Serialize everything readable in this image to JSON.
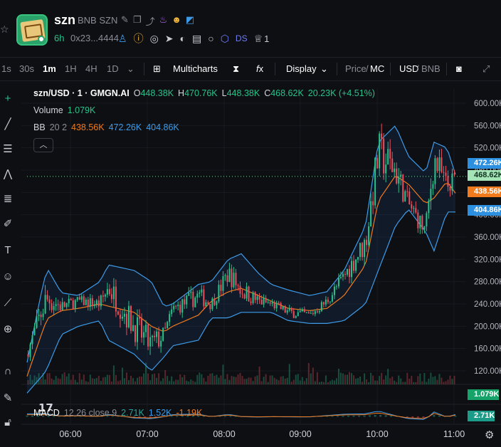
{
  "header": {
    "token_name": "szn",
    "token_subtitle": "BNB SZN",
    "age": "6h",
    "address": "0x23...4444",
    "ds_label": "DS",
    "watch_count": "1"
  },
  "toolbar": {
    "intervals": [
      "1s",
      "30s",
      "1m",
      "1H",
      "4H",
      "1D"
    ],
    "active_interval": "1m",
    "multicharts_label": "Multicharts",
    "display_label": "Display",
    "price_label": "Price",
    "mc_label": "MC",
    "usd_label": "USD",
    "bnb_label": "BNB"
  },
  "legend": {
    "symbol": "szn/USD · 1 · GMGN.AI",
    "ohlc": {
      "o_label": "O",
      "o": "448.38K",
      "h_label": "H",
      "h": "470.76K",
      "l_label": "L",
      "l": "448.38K",
      "c_label": "C",
      "c": "468.62K",
      "change": "20.23K (+4.51%)"
    },
    "volume_label": "Volume",
    "volume_value": "1.079K",
    "bb_label": "BB",
    "bb_params": "20 2",
    "bb_basis": "438.56K",
    "bb_upper": "472.26K",
    "bb_lower": "404.86K"
  },
  "macd": {
    "label": "MACD",
    "params": "12 26 close 9",
    "macd": "2.71K",
    "signal": "1.52K",
    "hist": "-1.19K"
  },
  "price_tags": {
    "upper": "472.26K",
    "last": "468.62K",
    "basis": "438.56K",
    "lower": "404.86K",
    "volume": "1.079K",
    "macd": "2.71K"
  },
  "colors": {
    "up": "#29c28a",
    "down": "#e8505b",
    "basis": "#f07a1c",
    "bands": "#3d9be9",
    "background": "#0e0f13"
  },
  "chart_data": {
    "type": "line",
    "title": "szn/USD · 1 · GMGN.AI",
    "y_ticks": [
      "600.00K",
      "560.00K",
      "520.00K",
      "480.00K",
      "440.00K",
      "400.00K",
      "360.00K",
      "320.00K",
      "280.00K",
      "240.00K",
      "200.00K",
      "160.00K",
      "120.00K"
    ],
    "x_ticks": [
      "06:00",
      "07:00",
      "08:00",
      "09:00",
      "10:00",
      "11:00"
    ],
    "ylim": [
      80,
      610
    ],
    "x": [
      0.0,
      0.04,
      0.05,
      0.08,
      0.12,
      0.17,
      0.19,
      0.25,
      0.29,
      0.32,
      0.34,
      0.4,
      0.43,
      0.47,
      0.5,
      0.54,
      0.57,
      0.61,
      0.66,
      0.7,
      0.74,
      0.79,
      0.82,
      0.86,
      0.89,
      0.93,
      0.95,
      0.98,
      1.0
    ],
    "series": [
      {
        "name": "Close",
        "values": [
          150,
          240,
          250,
          235,
          245,
          240,
          270,
          200,
          165,
          185,
          230,
          255,
          240,
          295,
          265,
          245,
          240,
          225,
          220,
          245,
          290,
          350,
          510,
          480,
          420,
          370,
          500,
          450,
          468.62
        ]
      },
      {
        "name": "BB Basis",
        "values": [
          110,
          200,
          215,
          228,
          232,
          240,
          236,
          225,
          200,
          190,
          200,
          220,
          245,
          262,
          268,
          255,
          245,
          232,
          228,
          232,
          255,
          310,
          425,
          470,
          455,
          420,
          430,
          460,
          438.56
        ]
      },
      {
        "name": "BB Upper",
        "values": [
          135,
          285,
          300,
          260,
          255,
          280,
          310,
          300,
          280,
          235,
          240,
          275,
          280,
          320,
          330,
          295,
          275,
          265,
          255,
          262,
          300,
          380,
          530,
          560,
          505,
          475,
          530,
          520,
          472.26
        ]
      },
      {
        "name": "BB Lower",
        "values": [
          80,
          115,
          130,
          185,
          200,
          210,
          175,
          150,
          120,
          145,
          165,
          175,
          215,
          215,
          225,
          225,
          225,
          210,
          205,
          205,
          210,
          240,
          300,
          380,
          410,
          370,
          335,
          405,
          404.86
        ]
      }
    ],
    "last_price": 468.62
  }
}
